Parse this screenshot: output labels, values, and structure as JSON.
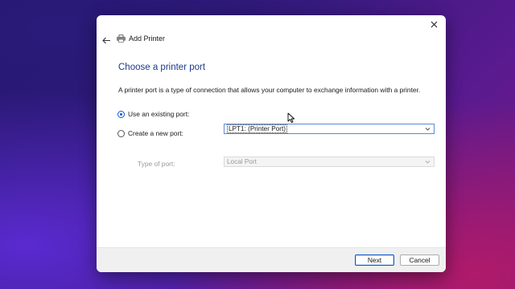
{
  "window": {
    "title": "Add Printer",
    "icon": "printer-icon"
  },
  "controls": {
    "close_icon": "close-icon",
    "back_icon": "back-arrow-icon"
  },
  "main": {
    "heading": "Choose a printer port",
    "description": "A printer port is a type of connection that allows your computer to exchange information with a printer.",
    "options": [
      {
        "label": "Use an existing port:",
        "selected": true
      },
      {
        "label": "Create a new port:",
        "selected": false
      }
    ],
    "existing_port": {
      "value": "LPT1: (Printer Port)"
    },
    "type_of_port": {
      "label": "Type of port:",
      "value": "Local Port",
      "disabled": true
    }
  },
  "footer": {
    "next_label": "Next",
    "cancel_label": "Cancel"
  },
  "colors": {
    "accent": "#0a58ca",
    "heading": "#1c3a8a"
  }
}
